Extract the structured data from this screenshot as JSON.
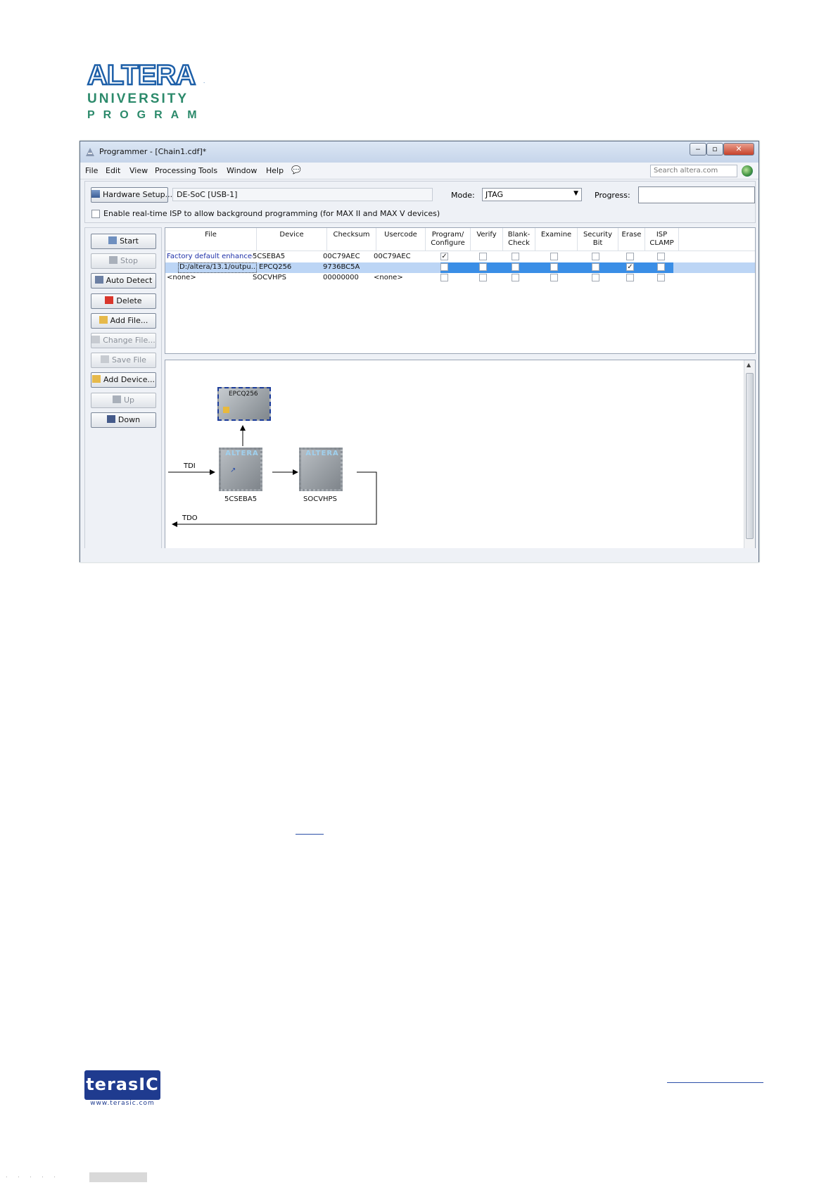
{
  "window": {
    "title": "Programmer - [Chain1.cdf]*",
    "menu": [
      "File",
      "Edit",
      "View",
      "Processing",
      "Tools",
      "Window",
      "Help"
    ],
    "search_placeholder": "Search altera.com"
  },
  "hardware": {
    "button_label": "Hardware Setup...",
    "field_value": "DE-SoC [USB-1]",
    "mode_label": "Mode:",
    "mode_value": "JTAG",
    "progress_label": "Progress:",
    "isp_label": "Enable real-time ISP to allow background programming (for MAX II and MAX V devices)"
  },
  "left_buttons": [
    {
      "label": "Start",
      "icon": "start-icon",
      "enabled": true
    },
    {
      "label": "Stop",
      "icon": "stop-icon",
      "enabled": false
    },
    {
      "label": "Auto Detect",
      "icon": "auto-detect-icon",
      "enabled": true
    },
    {
      "label": "Delete",
      "icon": "delete-icon",
      "enabled": true
    },
    {
      "label": "Add File...",
      "icon": "add-file-icon",
      "enabled": true
    },
    {
      "label": "Change File...",
      "icon": "change-file-icon",
      "enabled": false
    },
    {
      "label": "Save File",
      "icon": "save-file-icon",
      "enabled": false
    },
    {
      "label": "Add Device...",
      "icon": "add-device-icon",
      "enabled": true
    },
    {
      "label": "Up",
      "icon": "up-icon",
      "enabled": false
    },
    {
      "label": "Down",
      "icon": "down-icon",
      "enabled": true
    }
  ],
  "table": {
    "headers": [
      "File",
      "Device",
      "Checksum",
      "Usercode",
      "Program/\nConfigure",
      "Verify",
      "Blank-\nCheck",
      "Examine",
      "Security\nBit",
      "Erase",
      "ISP\nCLAMP"
    ],
    "rows": [
      {
        "file": "Factory default enhanced...",
        "device": "5CSEBA5",
        "checksum": "00C79AEC",
        "usercode": "00C79AEC",
        "checks": [
          true,
          false,
          false,
          false,
          false,
          false,
          false
        ],
        "selected": false
      },
      {
        "file": "D:/altera/13.1/outpu...",
        "device": "EPCQ256",
        "checksum": "9736BC5A",
        "usercode": "",
        "checks": [
          false,
          false,
          false,
          false,
          false,
          true,
          false
        ],
        "selected": true
      },
      {
        "file": "<none>",
        "device": "SOCVHPS",
        "checksum": "00000000",
        "usercode": "<none>",
        "checks": [
          false,
          false,
          false,
          false,
          false,
          false,
          false
        ],
        "selected": false
      }
    ]
  },
  "diagram": {
    "tdi": "TDI",
    "tdo": "TDO",
    "flash": "EPCQ256",
    "chip_logo": "ALTERA",
    "device1": "5CSEBA5",
    "device2": "SOCVHPS"
  },
  "branding": {
    "altera_word": "ALTERA",
    "university": "UNIVERSITY",
    "program": "PROGRAM",
    "terasic": "terasIC",
    "terasic_url": "www.terasic.com"
  },
  "colors": {
    "altera_blue": "#1d5fa8",
    "altera_green": "#2c8a6b",
    "selection": "#bcd5f5",
    "selection_band": "#3a8ee6",
    "terasic_blue": "#1f3b8f"
  }
}
